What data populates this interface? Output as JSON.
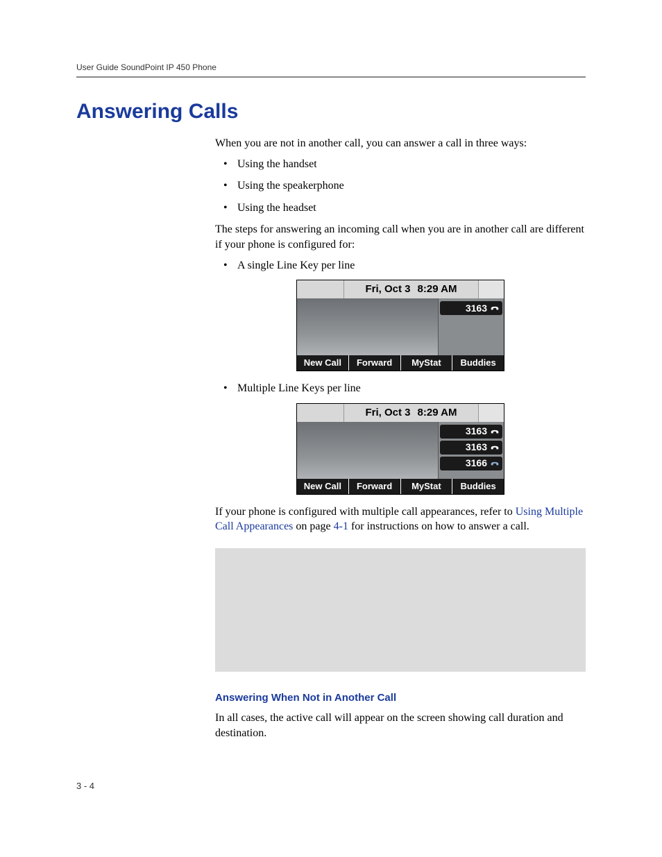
{
  "header": {
    "running": "User Guide SoundPoint IP 450 Phone"
  },
  "title": "Answering Calls",
  "intro": "When you are not in another call, you can answer a call in three ways:",
  "ways": [
    "Using the handset",
    "Using the speakerphone",
    "Using the headset"
  ],
  "steps_intro": "The steps for answering an incoming call when you are in another call are different if your phone is configured for:",
  "config1": "A single Line Key per line",
  "config2": "Multiple Line Keys per line",
  "lcd": {
    "date": "Fri, Oct 3",
    "time": "8:29 AM",
    "soft": [
      "New Call",
      "Forward",
      "MyStat",
      "Buddies"
    ],
    "single_lines": [
      "3163"
    ],
    "multi_lines": [
      "3163",
      "3163",
      "3166"
    ]
  },
  "after_lcd": {
    "pre": "If your phone is configured with multiple call appearances, refer to ",
    "link1": "Using Multiple Call Appearances",
    "mid": " on page ",
    "link2": "4-1",
    "post": " for instructions on how to answer a call."
  },
  "subhead": "Answering When Not in Another Call",
  "sub_body": "In all cases, the active call will appear on the screen showing call duration and destination.",
  "page_num": "3 - 4"
}
